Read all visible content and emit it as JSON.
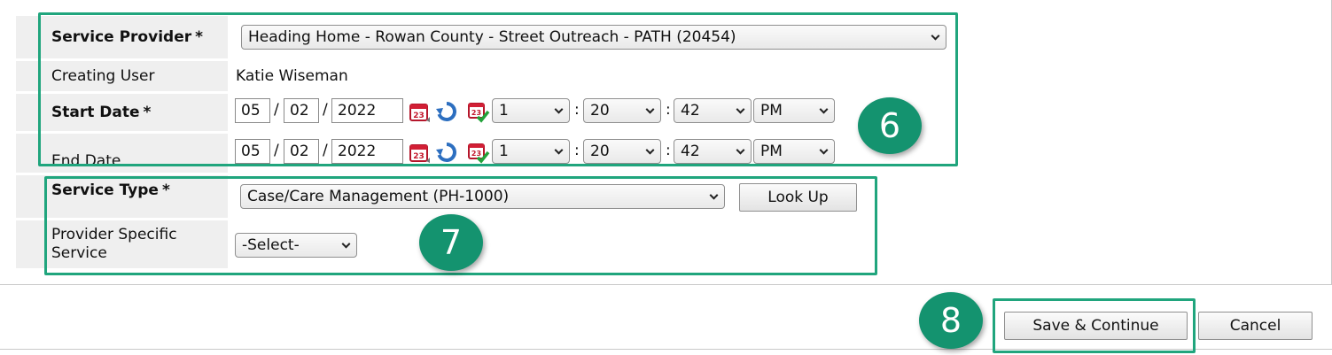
{
  "form": {
    "service_provider": {
      "label": "Service Provider",
      "required_mark": "*",
      "value": "Heading Home - Rowan County - Street Outreach - PATH (20454)"
    },
    "creating_user": {
      "label": "Creating User",
      "value": "Katie Wiseman"
    },
    "start_date": {
      "label": "Start Date",
      "required_mark": "*",
      "month": "05",
      "day": "02",
      "year": "2022",
      "hour": "1",
      "minute": "20",
      "second": "42",
      "ampm": "PM",
      "date_sep": "/",
      "time_sep": ":"
    },
    "end_date": {
      "label": "End Date",
      "month": "05",
      "day": "02",
      "year": "2022",
      "hour": "1",
      "minute": "20",
      "second": "42",
      "ampm": "PM",
      "date_sep": "/",
      "time_sep": ":"
    },
    "service_type": {
      "label": "Service Type",
      "required_mark": "*",
      "value": "Case/Care Management (PH-1000)",
      "lookup_label": "Look Up"
    },
    "provider_specific_service": {
      "label_line1": "Provider Specific",
      "label_line2": "Service",
      "value": "-Select-"
    }
  },
  "actions": {
    "save_continue_label": "Save & Continue",
    "cancel_label": "Cancel"
  },
  "callouts": {
    "six": "6",
    "seven": "7",
    "eight": "8"
  },
  "colors": {
    "callout_green": "#14936f",
    "callout_border": "#20a57d",
    "label_bg": "#efefef"
  },
  "icons": {
    "calendar": "calendar-icon",
    "reset": "reset-arrow-icon",
    "today": "calendar-today-icon"
  }
}
